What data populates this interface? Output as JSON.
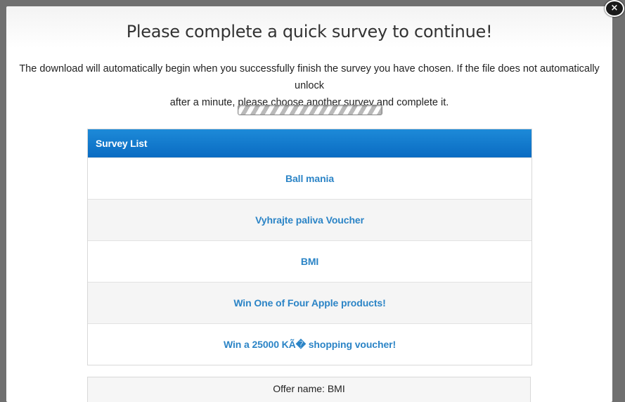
{
  "modal": {
    "title": "Please complete a quick survey to continue!",
    "description_line1": "The download will automatically begin when you successfully finish the survey you have chosen. If the file does not automatically unlock",
    "description_line2": "after a minute, please choose another survey and complete it.",
    "close_label": "×"
  },
  "survey_list": {
    "header": "Survey List",
    "items": [
      {
        "label": "Ball mania"
      },
      {
        "label": "Vyhrajte paliva Voucher"
      },
      {
        "label": "BMI"
      },
      {
        "label": "Win One of Four Apple products!"
      },
      {
        "label": "Win a 25000 KÃ� shopping voucher!"
      }
    ]
  },
  "offer": {
    "label": "Offer name: BMI"
  },
  "colors": {
    "header_blue": "#0a6bc2",
    "link_blue": "#2b84c6"
  }
}
